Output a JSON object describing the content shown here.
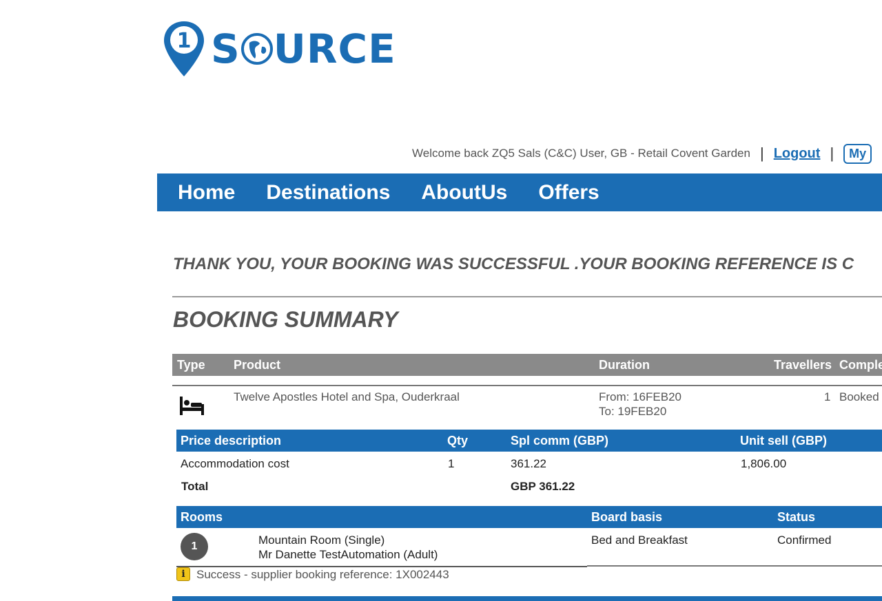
{
  "logo": {
    "wordmark_prefix": "S",
    "wordmark_suffix": "URCE",
    "pin_number": "1"
  },
  "header": {
    "welcome_text": "Welcome back ZQ5 Sals (C&C) User, GB - Retail Covent Garden",
    "separator": "|",
    "logout_label": "Logout",
    "my_label": "My"
  },
  "nav": {
    "items": [
      "Home",
      "Destinations",
      "AboutUs",
      "Offers"
    ]
  },
  "confirmation": {
    "message": "THANK YOU, YOUR BOOKING WAS SUCCESSFUL .YOUR BOOKING REFERENCE IS C"
  },
  "summary": {
    "title": "BOOKING SUMMARY",
    "columns": {
      "type": "Type",
      "product": "Product",
      "duration": "Duration",
      "travellers": "Travellers",
      "status": "Comple"
    },
    "row": {
      "type_icon": "bed-icon",
      "product": "Twelve Apostles Hotel and Spa, Ouderkraal",
      "duration_from": "From: 16FEB20",
      "duration_to": "To: 19FEB20",
      "travellers": "1",
      "status": "Booked"
    }
  },
  "price_table": {
    "columns": {
      "description": "Price description",
      "qty": "Qty",
      "spl_comm": "Spl comm (GBP)",
      "unit_sell": "Unit sell (GBP)"
    },
    "rows": [
      {
        "description": "Accommodation cost",
        "qty": "1",
        "spl_comm": "361.22",
        "unit_sell": "1,806.00"
      }
    ],
    "total_label": "Total",
    "total_value": "GBP 361.22"
  },
  "rooms_table": {
    "columns": {
      "rooms": "Rooms",
      "board_basis": "Board basis",
      "status": "Status"
    },
    "rows": [
      {
        "number": "1",
        "room_type": "Mountain Room (Single)",
        "guest": "Mr Danette TestAutomation (Adult)",
        "board_basis": "Bed and Breakfast",
        "status": "Confirmed"
      }
    ]
  },
  "supplier_message": {
    "icon": "info-icon",
    "text": "Success - supplier booking reference: 1X002443"
  },
  "colors": {
    "brand_blue": "#1b6db4",
    "header_grey": "#8a8a8a",
    "info_yellow": "#f0c419"
  }
}
